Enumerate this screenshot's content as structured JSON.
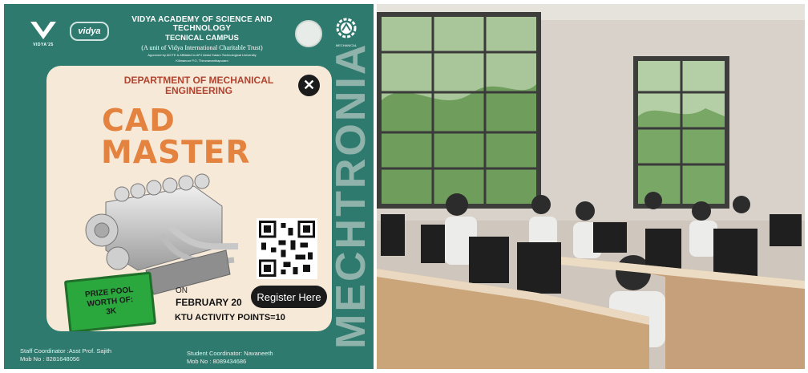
{
  "poster": {
    "logo_left_caption": "VIDYA'25",
    "logo_vidya_text": "vidya",
    "title": "VIDYA ACADEMY OF SCIENCE AND TECHNOLOGY",
    "campus": "TECNICAL CAMPUS",
    "trust": "(A unit of Vidya International Charitable Trust)",
    "approval": "Approved by AICTE & Affiliated to APJ Abdul Kalam Technological University",
    "location": "Kilimanoor P.O, Thiruvananthapuram",
    "mech_logo_caption": "MECHANICAL",
    "watermark": "MECHTRONIA",
    "department": "DEPARTMENT OF MECHANICAL ENGINEERING",
    "event_line1": "CAD",
    "event_line2": "MASTER",
    "close_icon_glyph": "✕",
    "prize": [
      "PRIZE POOL",
      "WORTH OF:",
      "3K"
    ],
    "on_label": "ON",
    "date": "FEBRUARY 20",
    "register_label": "Register Here",
    "ktu_points": "KTU ACTIVITY POINTS=10",
    "staff_coordinator": "Staff Coordinator :Asst Prof. Sajith",
    "staff_mob": "Mob No : 8281648056",
    "student_coordinator": "Student Coordinator: Navaneeth",
    "student_mob": "Mob No : 8089434686"
  },
  "colors": {
    "poster_bg": "#2f7a6e",
    "card_bg": "#f7e9d8",
    "accent_orange": "#e4833f",
    "dept_red": "#b2432f",
    "prize_green": "#2aa83d"
  }
}
